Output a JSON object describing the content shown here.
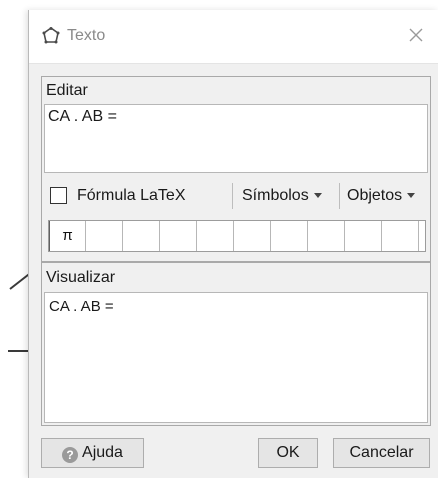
{
  "window": {
    "title": "Texto",
    "icon": "polygon-outline-icon",
    "close_icon": "close-icon"
  },
  "edit_section": {
    "label": "Editar",
    "content": "CA . AB =",
    "latex_checkbox": {
      "label": "Fórmula LaTeX",
      "checked": false
    },
    "symbols_menu": "Símbolos",
    "objects_menu": "Objetos",
    "symbol_buttons": [
      "π",
      "",
      "",
      "",
      "",
      "",
      "",
      "",
      "",
      "",
      ""
    ]
  },
  "preview_section": {
    "label": "Visualizar",
    "content": "CA . AB ="
  },
  "buttons": {
    "help": "Ajuda",
    "ok": "OK",
    "cancel": "Cancelar"
  }
}
